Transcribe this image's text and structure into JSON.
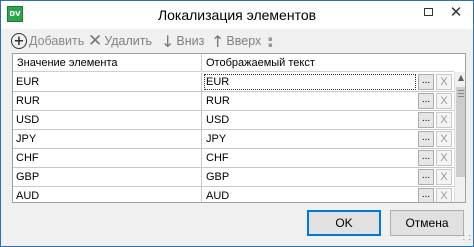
{
  "window": {
    "title": "Локализация элементов",
    "icon_label": "DV",
    "maximize_icon": "maximize-icon",
    "close_icon": "close-icon",
    "close_glyph": "✕"
  },
  "toolbar": {
    "add": {
      "label": "Добавить",
      "icon": "plus-circle-icon",
      "glyph": "+"
    },
    "delete": {
      "label": "Удалить",
      "icon": "x-icon",
      "glyph": "✕"
    },
    "down": {
      "label": "Вниз",
      "icon": "arrow-down-icon",
      "glyph": "↓"
    },
    "up": {
      "label": "Вверх",
      "icon": "arrow-up-icon",
      "glyph": "↑"
    }
  },
  "grid": {
    "columns": [
      "Значение элемента",
      "Отображаемый текст"
    ],
    "rows": [
      {
        "value": "EUR",
        "text": "EUR"
      },
      {
        "value": "RUR",
        "text": "RUR"
      },
      {
        "value": "USD",
        "text": "USD"
      },
      {
        "value": "JPY",
        "text": "JPY"
      },
      {
        "value": "CHF",
        "text": "CHF"
      },
      {
        "value": "GBP",
        "text": "GBP"
      },
      {
        "value": "AUD",
        "text": "AUD"
      }
    ],
    "row_button_dots": "...",
    "row_button_clear": "X",
    "scroll_up_glyph": "▲"
  },
  "footer": {
    "ok_label": "OK",
    "cancel_label": "Отмена"
  },
  "colors": {
    "accent": "#0078d7",
    "icon_bg": "#2ea44f",
    "border": "#2b6fbf"
  }
}
